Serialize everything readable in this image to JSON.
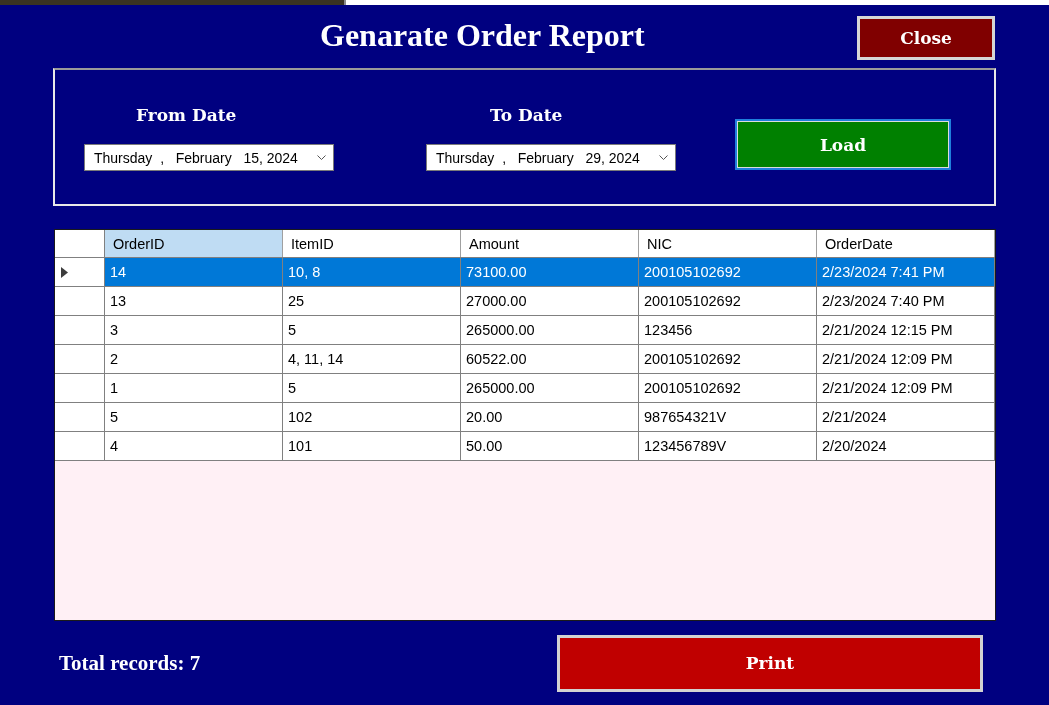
{
  "title": "Genarate Order Report",
  "close_button": {
    "label": "Close"
  },
  "filter": {
    "date_filters": [
      {
        "label": "From Date",
        "value": "Thursday  ,   February   15, 2024"
      },
      {
        "label": "To Date",
        "value": "Thursday  ,   February   29, 2024"
      }
    ],
    "load_button": {
      "label": "Load"
    }
  },
  "table": {
    "columns": [
      {
        "label": "OrderID",
        "selected": true
      },
      {
        "label": "ItemID",
        "selected": false
      },
      {
        "label": "Amount",
        "selected": false
      },
      {
        "label": "NIC",
        "selected": false
      },
      {
        "label": "OrderDate",
        "selected": false
      }
    ],
    "rows": [
      {
        "selected": true,
        "cells": [
          "14",
          "10, 8",
          "73100.00",
          "200105102692",
          "2/23/2024 7:41 PM"
        ]
      },
      {
        "selected": false,
        "cells": [
          "13",
          "25",
          "27000.00",
          "200105102692",
          "2/23/2024 7:40 PM"
        ]
      },
      {
        "selected": false,
        "cells": [
          "3",
          "5",
          "265000.00",
          "123456",
          "2/21/2024 12:15 PM"
        ]
      },
      {
        "selected": false,
        "cells": [
          "2",
          "4, 11, 14",
          "60522.00",
          "200105102692",
          "2/21/2024 12:09 PM"
        ]
      },
      {
        "selected": false,
        "cells": [
          "1",
          "5",
          "265000.00",
          "200105102692",
          "2/21/2024 12:09 PM"
        ]
      },
      {
        "selected": false,
        "cells": [
          "5",
          "102",
          "20.00",
          "987654321V",
          "2/21/2024"
        ]
      },
      {
        "selected": false,
        "cells": [
          "4",
          "101",
          "50.00",
          "123456789V",
          "2/20/2024"
        ]
      }
    ]
  },
  "footer": {
    "total_records": "Total records: 7",
    "print_button": {
      "label": "Print"
    }
  }
}
